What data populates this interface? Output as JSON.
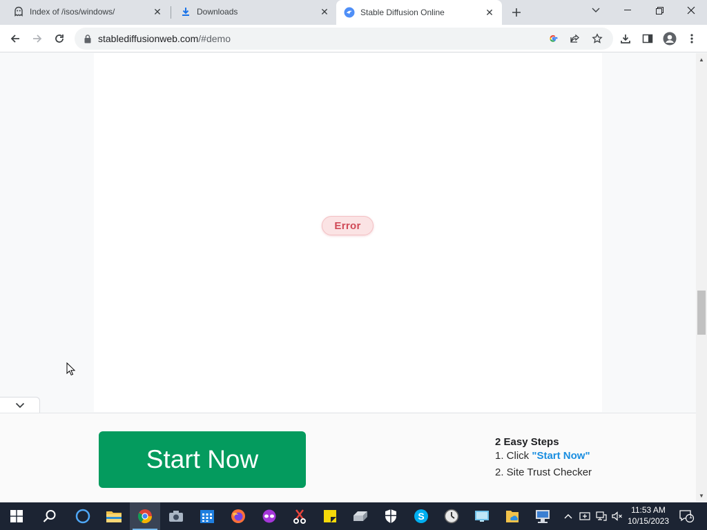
{
  "browser": {
    "tabs": [
      {
        "title": "Index of /isos/windows/",
        "icon": "ghost-icon",
        "active": false
      },
      {
        "title": "Downloads",
        "icon": "download-icon",
        "active": false
      },
      {
        "title": "Stable Diffusion Online",
        "icon": "sd-logo-icon",
        "active": true
      }
    ],
    "url_host": "stablediffusionweb.com",
    "url_path": "/#demo"
  },
  "page": {
    "error_label": "Error",
    "ad": {
      "start_button": "Start Now",
      "steps_title": "2 Easy Steps",
      "step1_prefix": "1. Click ",
      "step1_highlight": "\"Start Now\"",
      "step2": "2. Site Trust Checker"
    }
  },
  "taskbar": {
    "time": "11:53 AM",
    "date": "10/15/2023",
    "notification_count": "1",
    "apps": [
      "start-icon",
      "search-icon",
      "cortana-icon",
      "file-explorer-icon",
      "chrome-icon",
      "camera-icon",
      "calendar-icon",
      "firefox-icon",
      "vpn-mask-icon",
      "scissors-tool-icon",
      "sticky-notes-icon",
      "drive-icon",
      "shield-icon",
      "skype-icon",
      "clock-icon",
      "monitor-icon",
      "folder-cloud-icon",
      "network-pc-icon"
    ]
  },
  "colors": {
    "start_button": "#049b5e",
    "error_text": "#d04a57",
    "highlight_blue": "#1a8ee0",
    "taskbar": "#1c2433"
  }
}
